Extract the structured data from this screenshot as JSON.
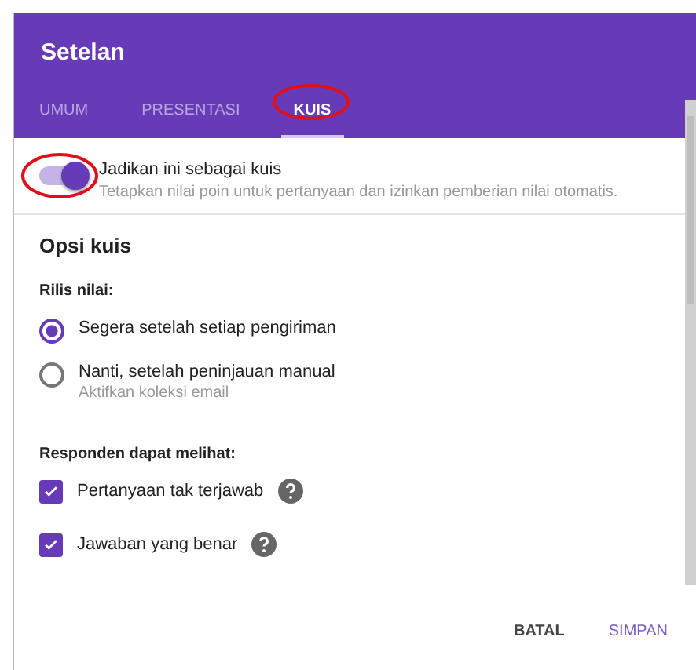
{
  "dialog": {
    "title": "Setelan"
  },
  "tabs": [
    {
      "label": "UMUM",
      "selected": false
    },
    {
      "label": "PRESENTASI",
      "selected": false
    },
    {
      "label": "KUIS",
      "selected": true
    }
  ],
  "quiz_toggle": {
    "label": "Jadikan ini sebagai kuis",
    "description": "Tetapkan nilai poin untuk pertanyaan dan izinkan pemberian nilai otomatis.",
    "on": true
  },
  "section_title": "Opsi kuis",
  "release": {
    "label": "Rilis nilai:",
    "options": [
      {
        "label": "Segera setelah setiap pengiriman",
        "selected": true
      },
      {
        "label": "Nanti, setelah peninjauan manual",
        "hint": "Aktifkan koleksi email",
        "selected": false
      }
    ]
  },
  "visibility": {
    "label": "Responden dapat melihat:",
    "options": [
      {
        "label": "Pertanyaan tak terjawab",
        "checked": true
      },
      {
        "label": "Jawaban yang benar",
        "checked": true
      }
    ]
  },
  "buttons": [
    {
      "label": "BATAL",
      "kind": "secondary"
    },
    {
      "label": "SIMPAN",
      "kind": "primary"
    }
  ]
}
